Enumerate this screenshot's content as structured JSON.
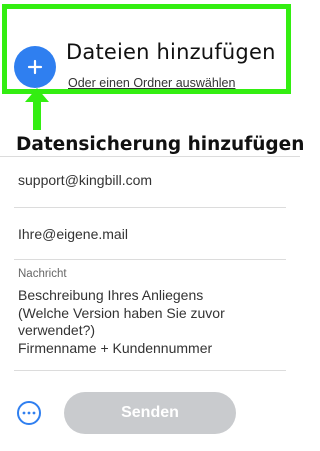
{
  "upload": {
    "title": "Dateien hinzufügen",
    "link": "Oder einen Ordner auswählen",
    "plus_icon": "plus-icon"
  },
  "section": {
    "heading": "Datensicherung hinzufügen"
  },
  "fields": {
    "to": "support@kingbill.com",
    "from": "Ihre@eigene.mail",
    "message_label": "Nachricht",
    "message_lines": [
      "Beschreibung Ihres Anliegens",
      "(Welche Version haben Sie zuvor",
      "verwendet?)",
      "Firmenname + Kundennummer"
    ]
  },
  "footer": {
    "more_icon": "more-options-icon",
    "send_label": "Senden"
  },
  "colors": {
    "highlight": "#33ee11",
    "accent": "#2f7ff0",
    "send_disabled": "#c9cbce"
  }
}
